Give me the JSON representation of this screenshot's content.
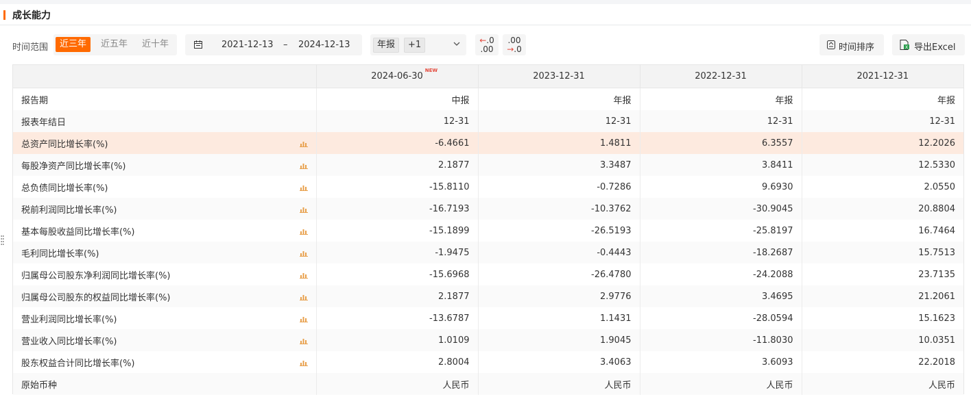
{
  "section": {
    "title": "成长能力"
  },
  "toolbar": {
    "range_label": "时间范围",
    "ranges": [
      {
        "label": "近三年",
        "active": true
      },
      {
        "label": "近五年",
        "active": false
      },
      {
        "label": "近十年",
        "active": false
      }
    ],
    "date_start": "2021-12-13",
    "date_sep": "–",
    "date_end": "2024-12-13",
    "report_type": "年报",
    "report_extra": "+1",
    "decimal_decrease": {
      "top": "←.0",
      "bottom": ".00"
    },
    "decimal_increase": {
      "top": ".00",
      "bottom": "→.0"
    },
    "sort_label": "时间排序",
    "export_label": "导出Excel"
  },
  "table": {
    "columns": [
      {
        "label": "2024-06-30",
        "badge": "NEW"
      },
      {
        "label": "2023-12-31",
        "badge": ""
      },
      {
        "label": "2022-12-31",
        "badge": ""
      },
      {
        "label": "2021-12-31",
        "badge": ""
      }
    ],
    "rows": [
      {
        "label": "报告期",
        "values": [
          "中报",
          "年报",
          "年报",
          "年报"
        ],
        "chart": false,
        "highlight": false
      },
      {
        "label": "报表年结日",
        "values": [
          "12-31",
          "12-31",
          "12-31",
          "12-31"
        ],
        "chart": false,
        "highlight": false
      },
      {
        "label": "总资产同比增长率(%)",
        "values": [
          "-6.4661",
          "1.4811",
          "6.3557",
          "12.2026"
        ],
        "chart": true,
        "highlight": true
      },
      {
        "label": "每股净资产同比增长率(%)",
        "values": [
          "2.1877",
          "3.3487",
          "3.8411",
          "12.5330"
        ],
        "chart": true,
        "highlight": false
      },
      {
        "label": "总负债同比增长率(%)",
        "values": [
          "-15.8110",
          "-0.7286",
          "9.6930",
          "2.0550"
        ],
        "chart": true,
        "highlight": false
      },
      {
        "label": "税前利润同比增长率(%)",
        "values": [
          "-16.7193",
          "-10.3762",
          "-30.9045",
          "20.8804"
        ],
        "chart": true,
        "highlight": false
      },
      {
        "label": "基本每股收益同比增长率(%)",
        "values": [
          "-15.1899",
          "-26.5193",
          "-25.8197",
          "16.7464"
        ],
        "chart": true,
        "highlight": false
      },
      {
        "label": "毛利同比增长率(%)",
        "values": [
          "-1.9475",
          "-0.4443",
          "-18.2687",
          "15.7513"
        ],
        "chart": true,
        "highlight": false
      },
      {
        "label": "归属母公司股东净利润同比增长率(%)",
        "values": [
          "-15.6968",
          "-26.4780",
          "-24.2088",
          "23.7135"
        ],
        "chart": true,
        "highlight": false
      },
      {
        "label": "归属母公司股东的权益同比增长率(%)",
        "values": [
          "2.1877",
          "2.9776",
          "3.4695",
          "21.2061"
        ],
        "chart": true,
        "highlight": false
      },
      {
        "label": "营业利润同比增长率(%)",
        "values": [
          "-13.6787",
          "1.1431",
          "-28.0594",
          "15.1623"
        ],
        "chart": true,
        "highlight": false
      },
      {
        "label": "营业收入同比增长率(%)",
        "values": [
          "1.0109",
          "1.9045",
          "-11.8030",
          "10.0351"
        ],
        "chart": true,
        "highlight": false
      },
      {
        "label": "股东权益合计同比增长率(%)",
        "values": [
          "2.8004",
          "3.4063",
          "3.6093",
          "22.2018"
        ],
        "chart": true,
        "highlight": false
      },
      {
        "label": "原始币种",
        "values": [
          "人民币",
          "人民币",
          "人民币",
          "人民币"
        ],
        "chart": false,
        "highlight": false
      }
    ]
  },
  "colors": {
    "accent": "#ff6a00",
    "highlight_row": "#fdeadf",
    "header_bg": "#f3f3f3",
    "new_badge": "#e4483b"
  }
}
